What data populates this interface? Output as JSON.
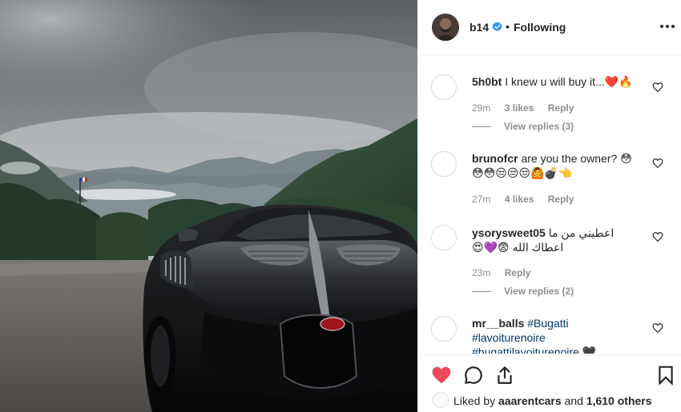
{
  "post": {
    "image_alt": "Black Bugatti La Voiture Noire parked on gravel in front of misty mountains",
    "author": {
      "username": "b14",
      "verified": true,
      "separator": "•",
      "follow_state": "Following"
    }
  },
  "comments": [
    {
      "username": "5h0bt",
      "text": "I knew u will buy it...❤️🔥",
      "time": "29m",
      "likes": "3 likes",
      "reply_label": "Reply",
      "view_replies": "View replies (3)"
    },
    {
      "username": "brunofcr",
      "text": "are you the owner? 😳",
      "text_line2": "😳😳😒😒😒🙆💣👈",
      "time": "27m",
      "likes": "4 likes",
      "reply_label": "Reply"
    },
    {
      "username": "ysorysweet05",
      "text": "اعطيني من ما",
      "text_line2": "😍💜😨 اعطاك الله",
      "time": "23m",
      "reply_label": "Reply",
      "view_replies": "View replies (2)"
    },
    {
      "username": "mr__balls",
      "text": "#Bugatti",
      "text_line2": "#lavoiturenoire",
      "text_line3": "#bugattilavoiturenoire 🖤"
    }
  ],
  "actions": {
    "like_icon": "heart-filled-icon",
    "comment_icon": "comment-icon",
    "share_icon": "share-icon",
    "save_icon": "bookmark-icon",
    "liked": true,
    "like_color": "#ed4956"
  },
  "likes_summary": {
    "prefix": "Liked by ",
    "user": "aaarentcars",
    "middle": " and ",
    "count": "1,610 others"
  }
}
